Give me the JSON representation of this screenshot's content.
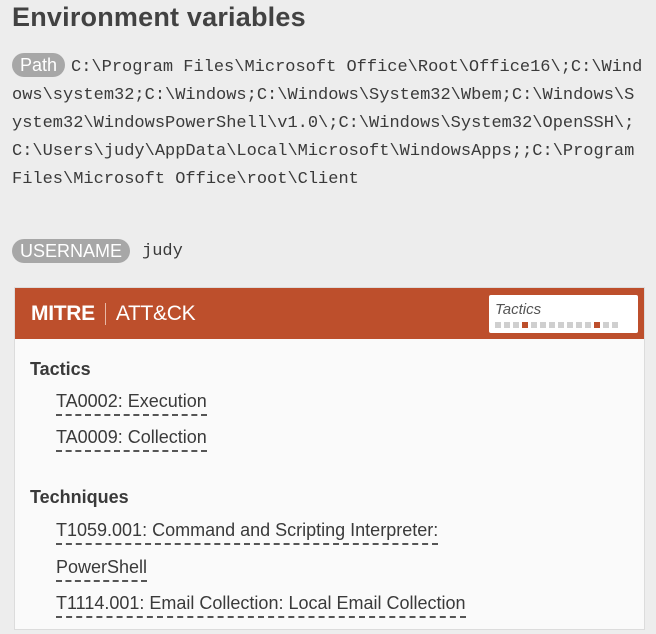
{
  "env": {
    "title": "Environment variables",
    "path_label": "Path",
    "path_value": "C:\\Program Files\\Microsoft Office\\Root\\Office16\\;C:\\Windows\\system32;C:\\Windows;C:\\Windows\\System32\\Wbem;C:\\Windows\\System32\\WindowsPowerShell\\v1.0\\;C:\\Windows\\System32\\OpenSSH\\;C:\\Users\\judy\\AppData\\Local\\Microsoft\\WindowsApps;;C:\\Program Files\\Microsoft Office\\root\\Client",
    "username_label": "USERNAME",
    "username_value": "judy"
  },
  "mitre": {
    "brand_left": "MITRE",
    "brand_right": "ATT&CK",
    "bar_color": "#bd4f2c",
    "tactics_box_label": "Tactics",
    "tactics_heading": "Tactics",
    "tactics": [
      "TA0002: Execution",
      "TA0009: Collection"
    ],
    "techniques_heading": "Techniques",
    "techniques": [
      "T1059.001: Command and Scripting Interpreter:",
      "PowerShell",
      "T1114.001: Email Collection: Local Email Collection"
    ]
  }
}
